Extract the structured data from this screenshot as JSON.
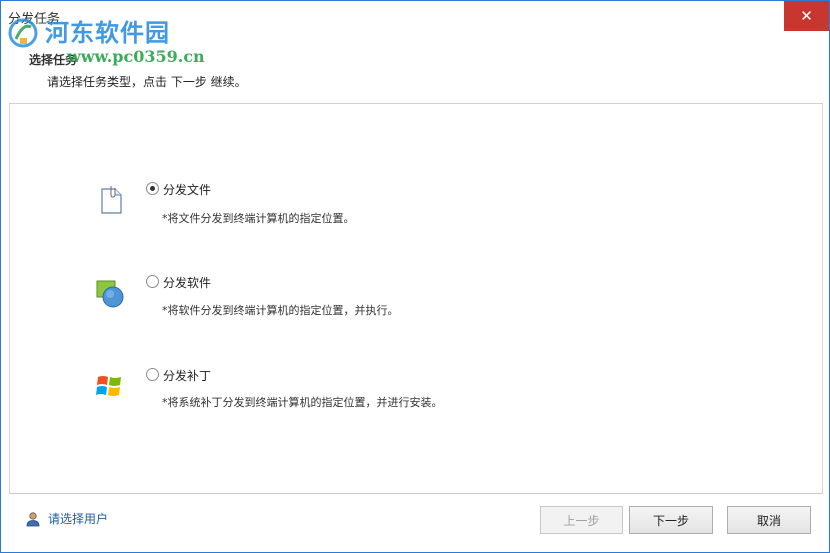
{
  "window": {
    "title": "分发任务"
  },
  "titlebar": {
    "close_symbol": "✕"
  },
  "watermark": {
    "name": "河东软件园",
    "url": "www.pc0359.cn"
  },
  "header": {
    "title": "选择任务",
    "subtitle": "请选择任务类型，点击 下一步 继续。"
  },
  "options": [
    {
      "label": "分发文件",
      "description": "*将文件分发到终端计算机的指定位置。",
      "selected": true,
      "icon": "file-icon"
    },
    {
      "label": "分发软件",
      "description": "*将软件分发到终端计算机的指定位置，并执行。",
      "selected": false,
      "icon": "software-icon"
    },
    {
      "label": "分发补丁",
      "description": "*将系统补丁分发到终端计算机的指定位置，并进行安装。",
      "selected": false,
      "icon": "windows-logo-icon"
    }
  ],
  "footer": {
    "user_link": "请选择用户",
    "prev_label": "上一步",
    "next_label": "下一步",
    "cancel_label": "取消"
  },
  "colors": {
    "accent": "#2b79d8",
    "close": "#c7362f",
    "link": "#1f5fa8"
  }
}
